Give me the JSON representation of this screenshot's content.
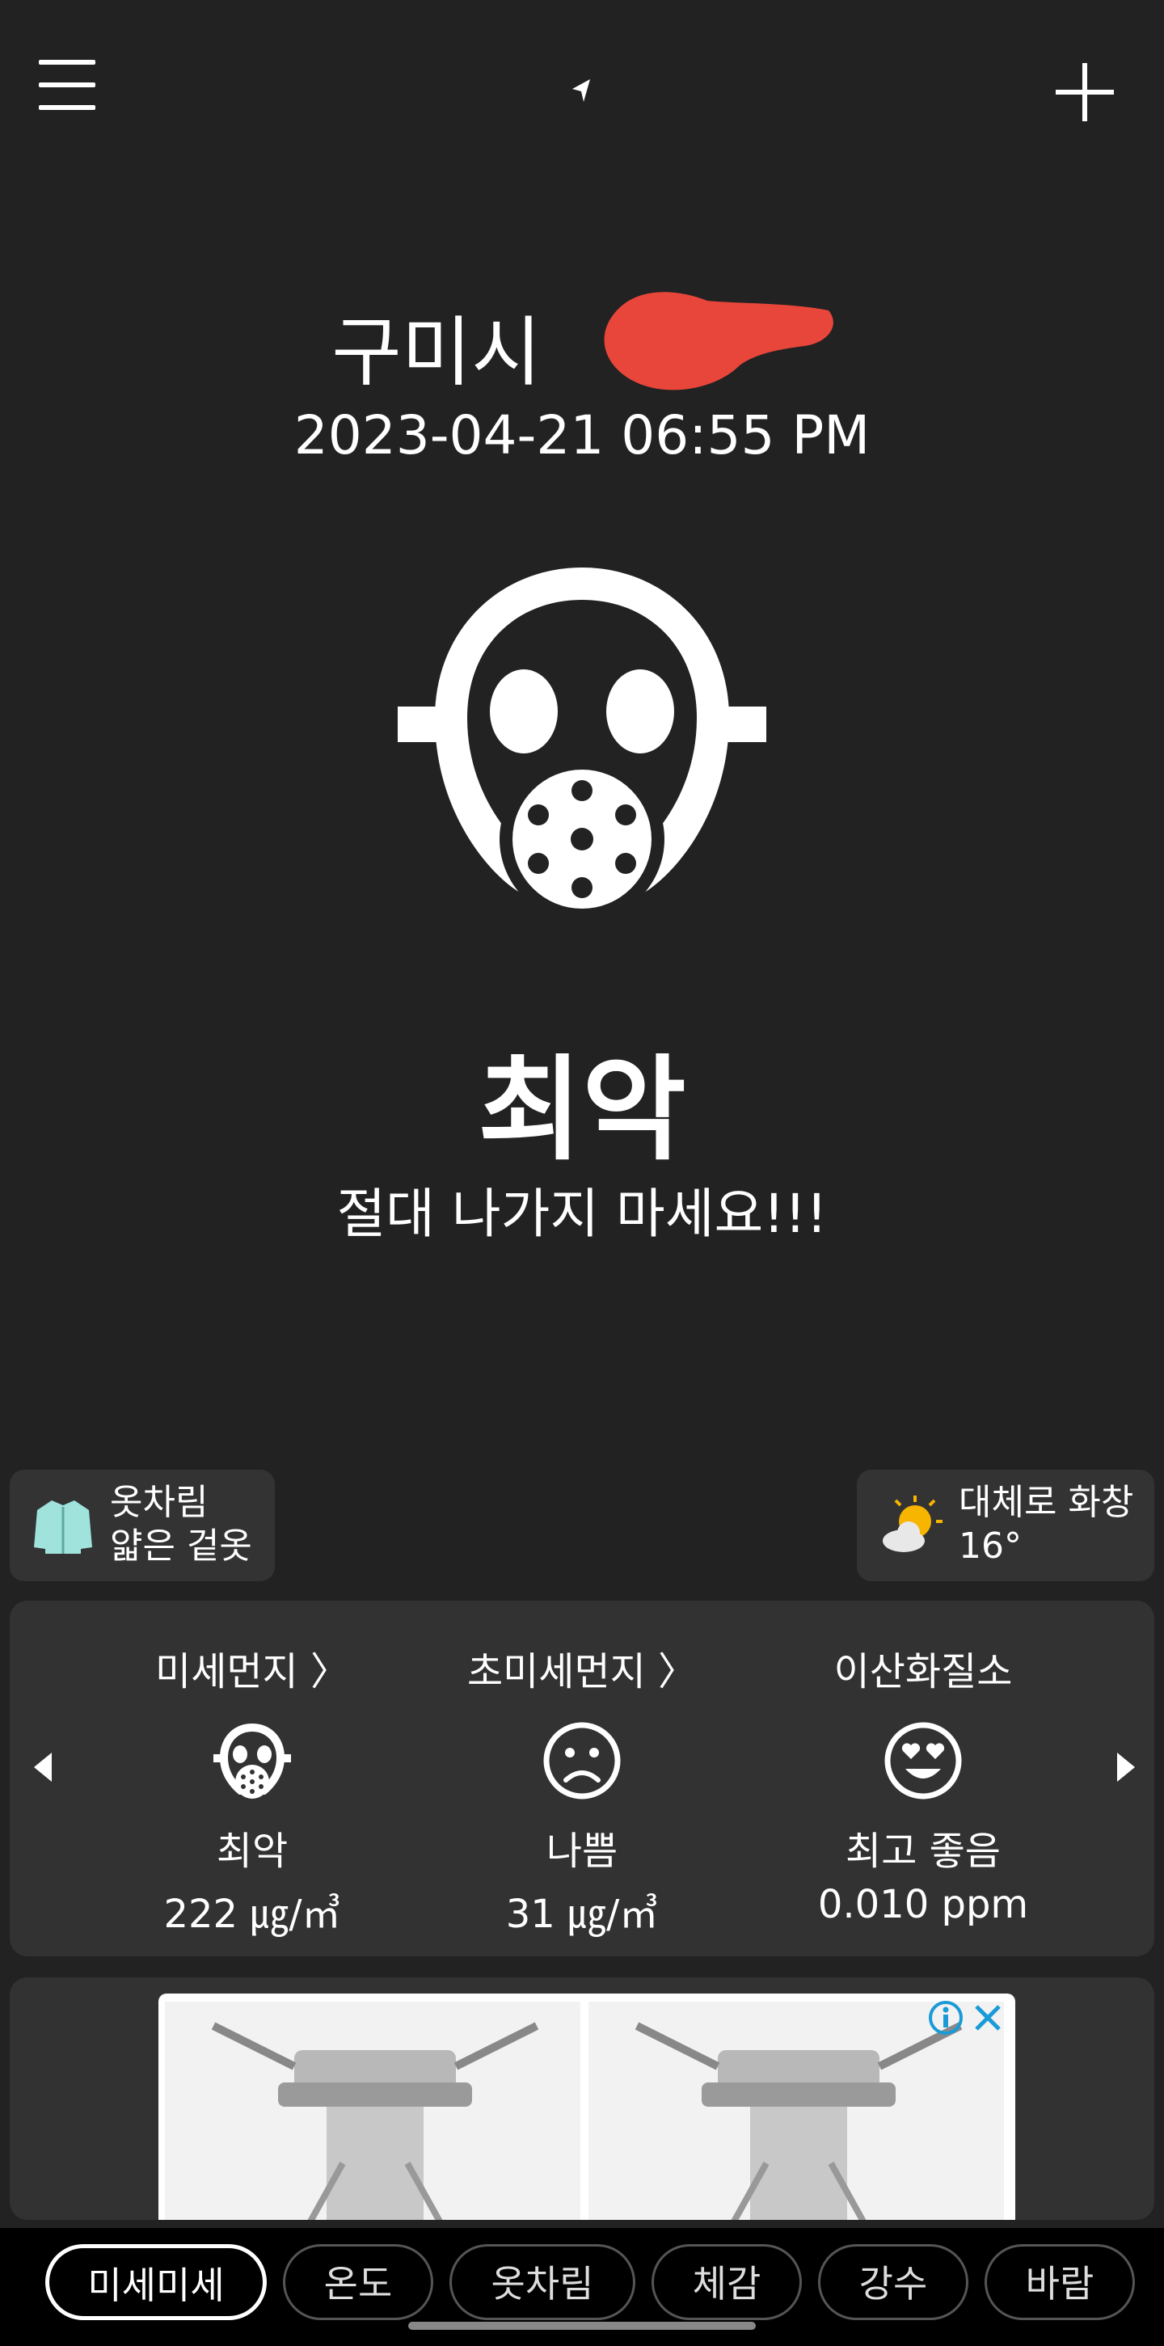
{
  "header": {
    "menu_icon": "hamburger-menu-icon",
    "location_icon": "location-arrow-icon",
    "add_icon": "plus-icon"
  },
  "location": {
    "city": "구미시",
    "datetime": "2023-04-21 06:55 PM"
  },
  "current": {
    "status_icon": "gas-mask-icon",
    "status": "최악",
    "advice": "절대 나가지 마세요!!!"
  },
  "chips": {
    "clothing": {
      "icon": "jacket-icon",
      "title": "옷차림",
      "value": "얇은 겉옷"
    },
    "weather": {
      "icon": "sun-cloud-icon",
      "title": "대체로 화창",
      "value": "16°"
    }
  },
  "pollutants": [
    {
      "title": "미세먼지 〉",
      "icon": "gas-mask-icon",
      "grade": "최악",
      "value": "222 ㎍/㎥"
    },
    {
      "title": "초미세먼지 〉",
      "icon": "sad-face-icon",
      "grade": "나쁨",
      "value": "31 ㎍/㎥"
    },
    {
      "title": "이산화질소",
      "icon": "heart-eyes-face-icon",
      "grade": "최고 좋음",
      "value": "0.010 ppm"
    }
  ],
  "ad": {
    "info_icon": "info-icon",
    "close_icon": "close-icon"
  },
  "tabs": [
    {
      "label": "미세미세",
      "active": true
    },
    {
      "label": "온도",
      "active": false
    },
    {
      "label": "옷차림",
      "active": false
    },
    {
      "label": "체감",
      "active": false
    },
    {
      "label": "강수",
      "active": false
    },
    {
      "label": "바람",
      "active": false
    }
  ],
  "colors": {
    "background": "#222222",
    "card": "#323232",
    "redaction": "#e8463a"
  }
}
